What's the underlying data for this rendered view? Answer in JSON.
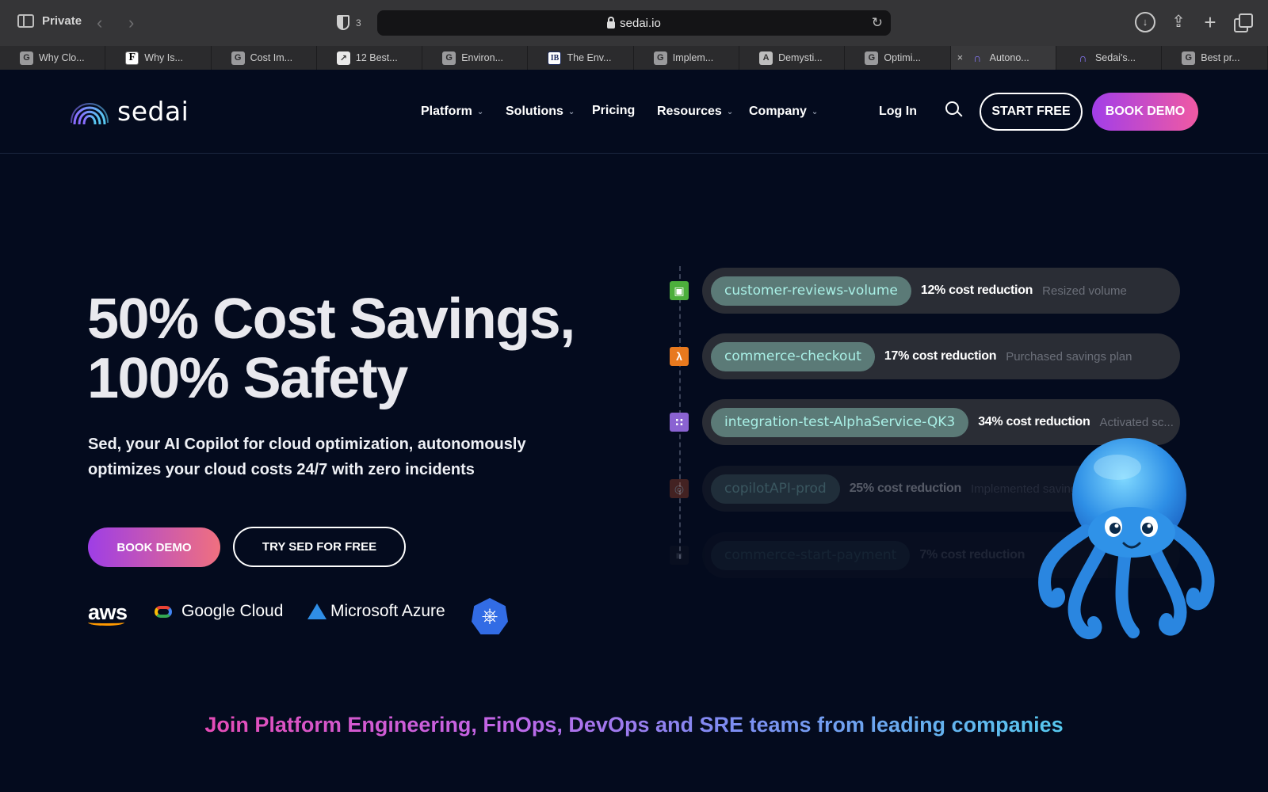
{
  "browser": {
    "private_label": "Private",
    "shield_count": "3",
    "url": "sedai.io",
    "tabs": [
      {
        "label": "Why Clo...",
        "favicon": "G"
      },
      {
        "label": "Why Is...",
        "favicon": "F"
      },
      {
        "label": "Cost Im...",
        "favicon": "G"
      },
      {
        "label": "12 Best...",
        "favicon": "rocket"
      },
      {
        "label": "Environ...",
        "favicon": "G"
      },
      {
        "label": "The Env...",
        "favicon": "IB"
      },
      {
        "label": "Implem...",
        "favicon": "G"
      },
      {
        "label": "Demysti...",
        "favicon": "A"
      },
      {
        "label": "Optimi...",
        "favicon": "G"
      },
      {
        "label": "Autono...",
        "favicon": "sedai",
        "active": true
      },
      {
        "label": "Sedai's...",
        "favicon": "sedai"
      },
      {
        "label": "Best pr...",
        "favicon": "G"
      }
    ]
  },
  "nav": {
    "logo_text": "sedai",
    "menu": [
      "Platform",
      "Solutions",
      "Pricing",
      "Resources",
      "Company"
    ],
    "login": "Log In",
    "start_free": "START FREE",
    "book_demo": "BOOK DEMO"
  },
  "hero": {
    "title_line1": "50% Cost Savings,",
    "title_line2": "100% Safety",
    "subtitle": "Sed, your AI Copilot for cloud optimization, autonomously optimizes your cloud costs 24/7 with zero incidents",
    "book_demo": "BOOK DEMO",
    "try_free": "TRY SED FOR FREE"
  },
  "cloud_logos": {
    "aws": "aws",
    "google": "Google Cloud",
    "azure": "Microsoft Azure"
  },
  "feed": [
    {
      "resource": "customer-reviews-volume",
      "reduction": "12% cost reduction",
      "action": "Resized volume",
      "icon_color": "#4caf3c"
    },
    {
      "resource": "commerce-checkout",
      "reduction": "17% cost reduction",
      "action": "Purchased savings plan",
      "icon_color": "#e8791e"
    },
    {
      "resource": "integration-test-AlphaService-QK3",
      "reduction": "34% cost reduction",
      "action": "Activated sc...",
      "icon_color": "#8a63d2"
    },
    {
      "resource": "copilotAPI-prod",
      "reduction": "25% cost reduction",
      "action": "Implemented saving",
      "icon_color": "#c9552b"
    },
    {
      "resource": "commerce-start-payment",
      "reduction": "7% cost reduction",
      "action": "",
      "icon_color": "#3a3a3a"
    }
  ],
  "join_text": "Join Platform Engineering, FinOps, DevOps and SRE teams from leading companies",
  "colors": {
    "page_bg": "#040b1e",
    "accent_gradient_start": "#a23ee8",
    "accent_gradient_end": "#f05aa3",
    "pill_text": "#a9f0e6"
  }
}
